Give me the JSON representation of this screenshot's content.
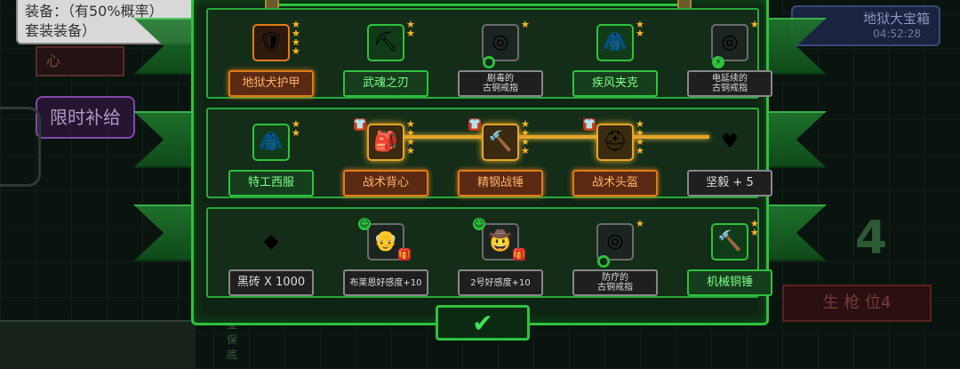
{
  "background": {
    "note_line1": "装备：（有50%概率）",
    "note_line2": "套装装备）",
    "limited_supply": "限时补给",
    "left_card": "心",
    "chest_title": "地狱大宝箱",
    "chest_time": "04:52:28",
    "big_number": "4",
    "bottom_left_text": "3星保底",
    "right_bottom": "生 枪 位4"
  },
  "rows": [
    [
      {
        "label": "地狱犬护甲",
        "style": "orange",
        "icon": "hellhound-armor-icon",
        "glyph": "🛡",
        "frame": "orangeb",
        "stars": 4
      },
      {
        "label": "武魂之刃",
        "style": "green",
        "icon": "pickaxe-blade-icon",
        "glyph": "⛏",
        "frame": "greenb",
        "stars": 2
      },
      {
        "label": "剧毒的\n古铜戒指",
        "style": "dark",
        "icon": "bronze-ring-icon",
        "glyph": "◎",
        "frame": "",
        "stars": 1,
        "tiny": true,
        "badge": "poison"
      },
      {
        "label": "疾风夹克",
        "style": "green",
        "icon": "gale-jacket-icon",
        "glyph": "🧥",
        "frame": "greenb",
        "stars": 2
      },
      {
        "label": "电延续的\n古铜戒指",
        "style": "dark",
        "icon": "bronze-ring-icon",
        "glyph": "◎",
        "frame": "",
        "stars": 1,
        "tiny": true,
        "badge": "lightning"
      }
    ],
    [
      {
        "label": "特工西服",
        "style": "green",
        "icon": "agent-suit-icon",
        "glyph": "🧥",
        "frame": "greenb",
        "stars": 2
      },
      {
        "label": "战术背心",
        "style": "orange",
        "icon": "tactical-vest-icon",
        "glyph": "🎒",
        "frame": "gold",
        "stars": 4,
        "shirt": true
      },
      {
        "label": "精钢战锤",
        "style": "orange",
        "icon": "steel-warhammer-icon",
        "glyph": "🔨",
        "frame": "gold",
        "stars": 4,
        "shirt": true
      },
      {
        "label": "战术头盔",
        "style": "orange",
        "icon": "tactical-helmet-icon",
        "glyph": "⛑",
        "frame": "gold",
        "stars": 4,
        "shirt": true
      },
      {
        "label": "坚毅 + 5",
        "style": "dark",
        "icon": "heart-shield-icon",
        "glyph": "♥",
        "frame": "none",
        "stars": 0
      }
    ],
    [
      {
        "label": "黑砖 X 1000",
        "style": "dark",
        "icon": "black-brick-icon",
        "glyph": "◆",
        "frame": "none",
        "stars": 0
      },
      {
        "label": "布莱恩好感度+10",
        "style": "dark",
        "icon": "brian-portrait-icon",
        "glyph": "👴",
        "frame": "",
        "stars": 0,
        "tiny": true,
        "smile": true,
        "gift": true
      },
      {
        "label": "2号好感度+10",
        "style": "dark",
        "icon": "no2-portrait-icon",
        "glyph": "🤠",
        "frame": "",
        "stars": 0,
        "tiny": true,
        "smile": true,
        "gift": true
      },
      {
        "label": "防疗的\n古铜戒指",
        "style": "dark",
        "icon": "bronze-ring-icon",
        "glyph": "◎",
        "frame": "",
        "stars": 1,
        "tiny": true,
        "badge": "green"
      },
      {
        "label": "机械铜锤",
        "style": "green",
        "icon": "mechanical-hammer-icon",
        "glyph": "🔨",
        "frame": "greenb",
        "stars": 2
      }
    ]
  ],
  "confirm": "✔"
}
